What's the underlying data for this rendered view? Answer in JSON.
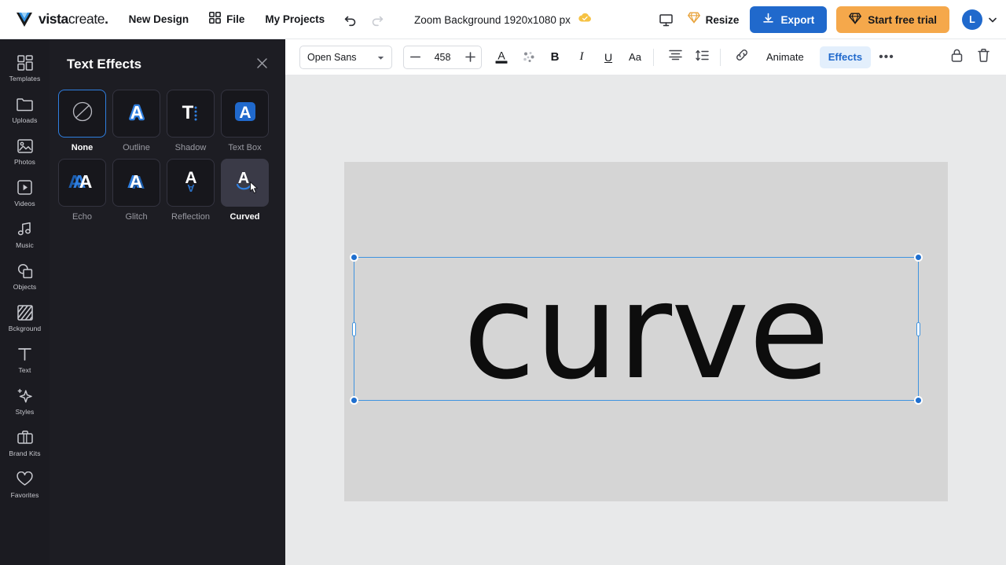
{
  "header": {
    "logo_text_bold": "vista",
    "logo_text_light": "create",
    "logo_dot": ".",
    "new_design": "New Design",
    "file": "File",
    "my_projects": "My Projects",
    "undo_icon": "undo-icon",
    "redo_icon": "redo-icon",
    "doc_title": "Zoom Background 1920x1080 px",
    "cloud_icon": "cloud-saved-icon",
    "present_icon": "present-icon",
    "resize_label": "Resize",
    "resize_icon": "diamond-premium-icon",
    "export_label": "Export",
    "export_icon": "download-icon",
    "trial_label": "Start free trial",
    "trial_icon": "diamond-premium-icon",
    "avatar_initial": "L",
    "avatar_caret_icon": "chevron-down-icon",
    "accent_blue": "#2069cc",
    "accent_orange": "#f5a84b"
  },
  "rail": {
    "items": [
      {
        "label": "Templates",
        "icon": "templates-icon"
      },
      {
        "label": "Uploads",
        "icon": "folder-icon"
      },
      {
        "label": "Photos",
        "icon": "photo-icon"
      },
      {
        "label": "Videos",
        "icon": "video-icon"
      },
      {
        "label": "Music",
        "icon": "music-icon"
      },
      {
        "label": "Objects",
        "icon": "objects-icon"
      },
      {
        "label": "Bckground",
        "icon": "background-icon"
      },
      {
        "label": "Text",
        "icon": "text-icon"
      },
      {
        "label": "Styles",
        "icon": "styles-sparkle-icon"
      },
      {
        "label": "Brand Kits",
        "icon": "briefcase-icon"
      },
      {
        "label": "Favorites",
        "icon": "heart-icon"
      }
    ]
  },
  "panel": {
    "title": "Text Effects",
    "close_icon": "close-icon",
    "effects": [
      {
        "label": "None",
        "icon": "none-slash-circle-icon",
        "state": "selected"
      },
      {
        "label": "Outline",
        "icon": "outline-a-icon",
        "state": "normal"
      },
      {
        "label": "Shadow",
        "icon": "shadow-t-icon",
        "state": "normal"
      },
      {
        "label": "Text Box",
        "icon": "text-box-a-icon",
        "state": "normal"
      },
      {
        "label": "Echo",
        "icon": "echo-a-icon",
        "state": "normal"
      },
      {
        "label": "Glitch",
        "icon": "glitch-a-icon",
        "state": "normal"
      },
      {
        "label": "Reflection",
        "icon": "reflection-a-icon",
        "state": "normal"
      },
      {
        "label": "Curved",
        "icon": "curved-a-icon",
        "state": "hovered"
      }
    ]
  },
  "toolbar": {
    "font_family": "Open Sans",
    "font_caret_icon": "chevron-down-icon",
    "decrease_icon": "minus-icon",
    "font_size": "458",
    "increase_icon": "plus-icon",
    "text_color_icon": "text-color-a-icon",
    "highlight_icon": "color-palette-icon",
    "bold_label": "B",
    "italic_label": "I",
    "underline_label": "U",
    "case_label": "Aa",
    "align_icon": "align-center-icon",
    "line_spacing_icon": "line-spacing-icon",
    "link_icon": "link-icon",
    "animate_label": "Animate",
    "effects_label": "Effects",
    "more_label": "•••",
    "lock_icon": "lock-icon",
    "delete_icon": "trash-icon"
  },
  "canvas": {
    "text": "curve",
    "background_color": "#d5d5d5",
    "workspace_color": "#e8e9ea",
    "selection_color": "#3e93e0",
    "cursor_icon": "pointer-cursor"
  }
}
